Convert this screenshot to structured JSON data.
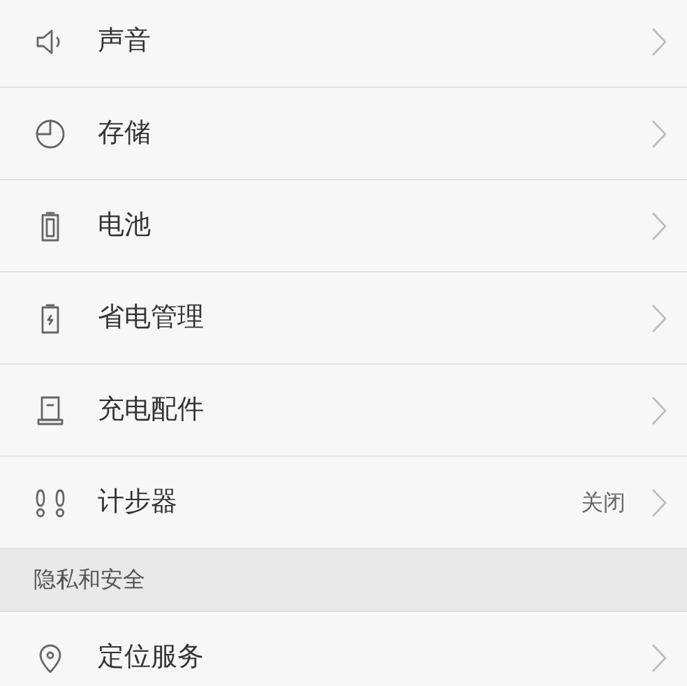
{
  "settings": [
    {
      "label": "声音"
    },
    {
      "label": "存储"
    },
    {
      "label": "电池"
    },
    {
      "label": "省电管理"
    },
    {
      "label": "充电配件"
    },
    {
      "label": "计步器",
      "value": "关闭"
    }
  ],
  "privacy_section": {
    "title": "隐私和安全",
    "settings": [
      {
        "label": "定位服务"
      }
    ]
  }
}
